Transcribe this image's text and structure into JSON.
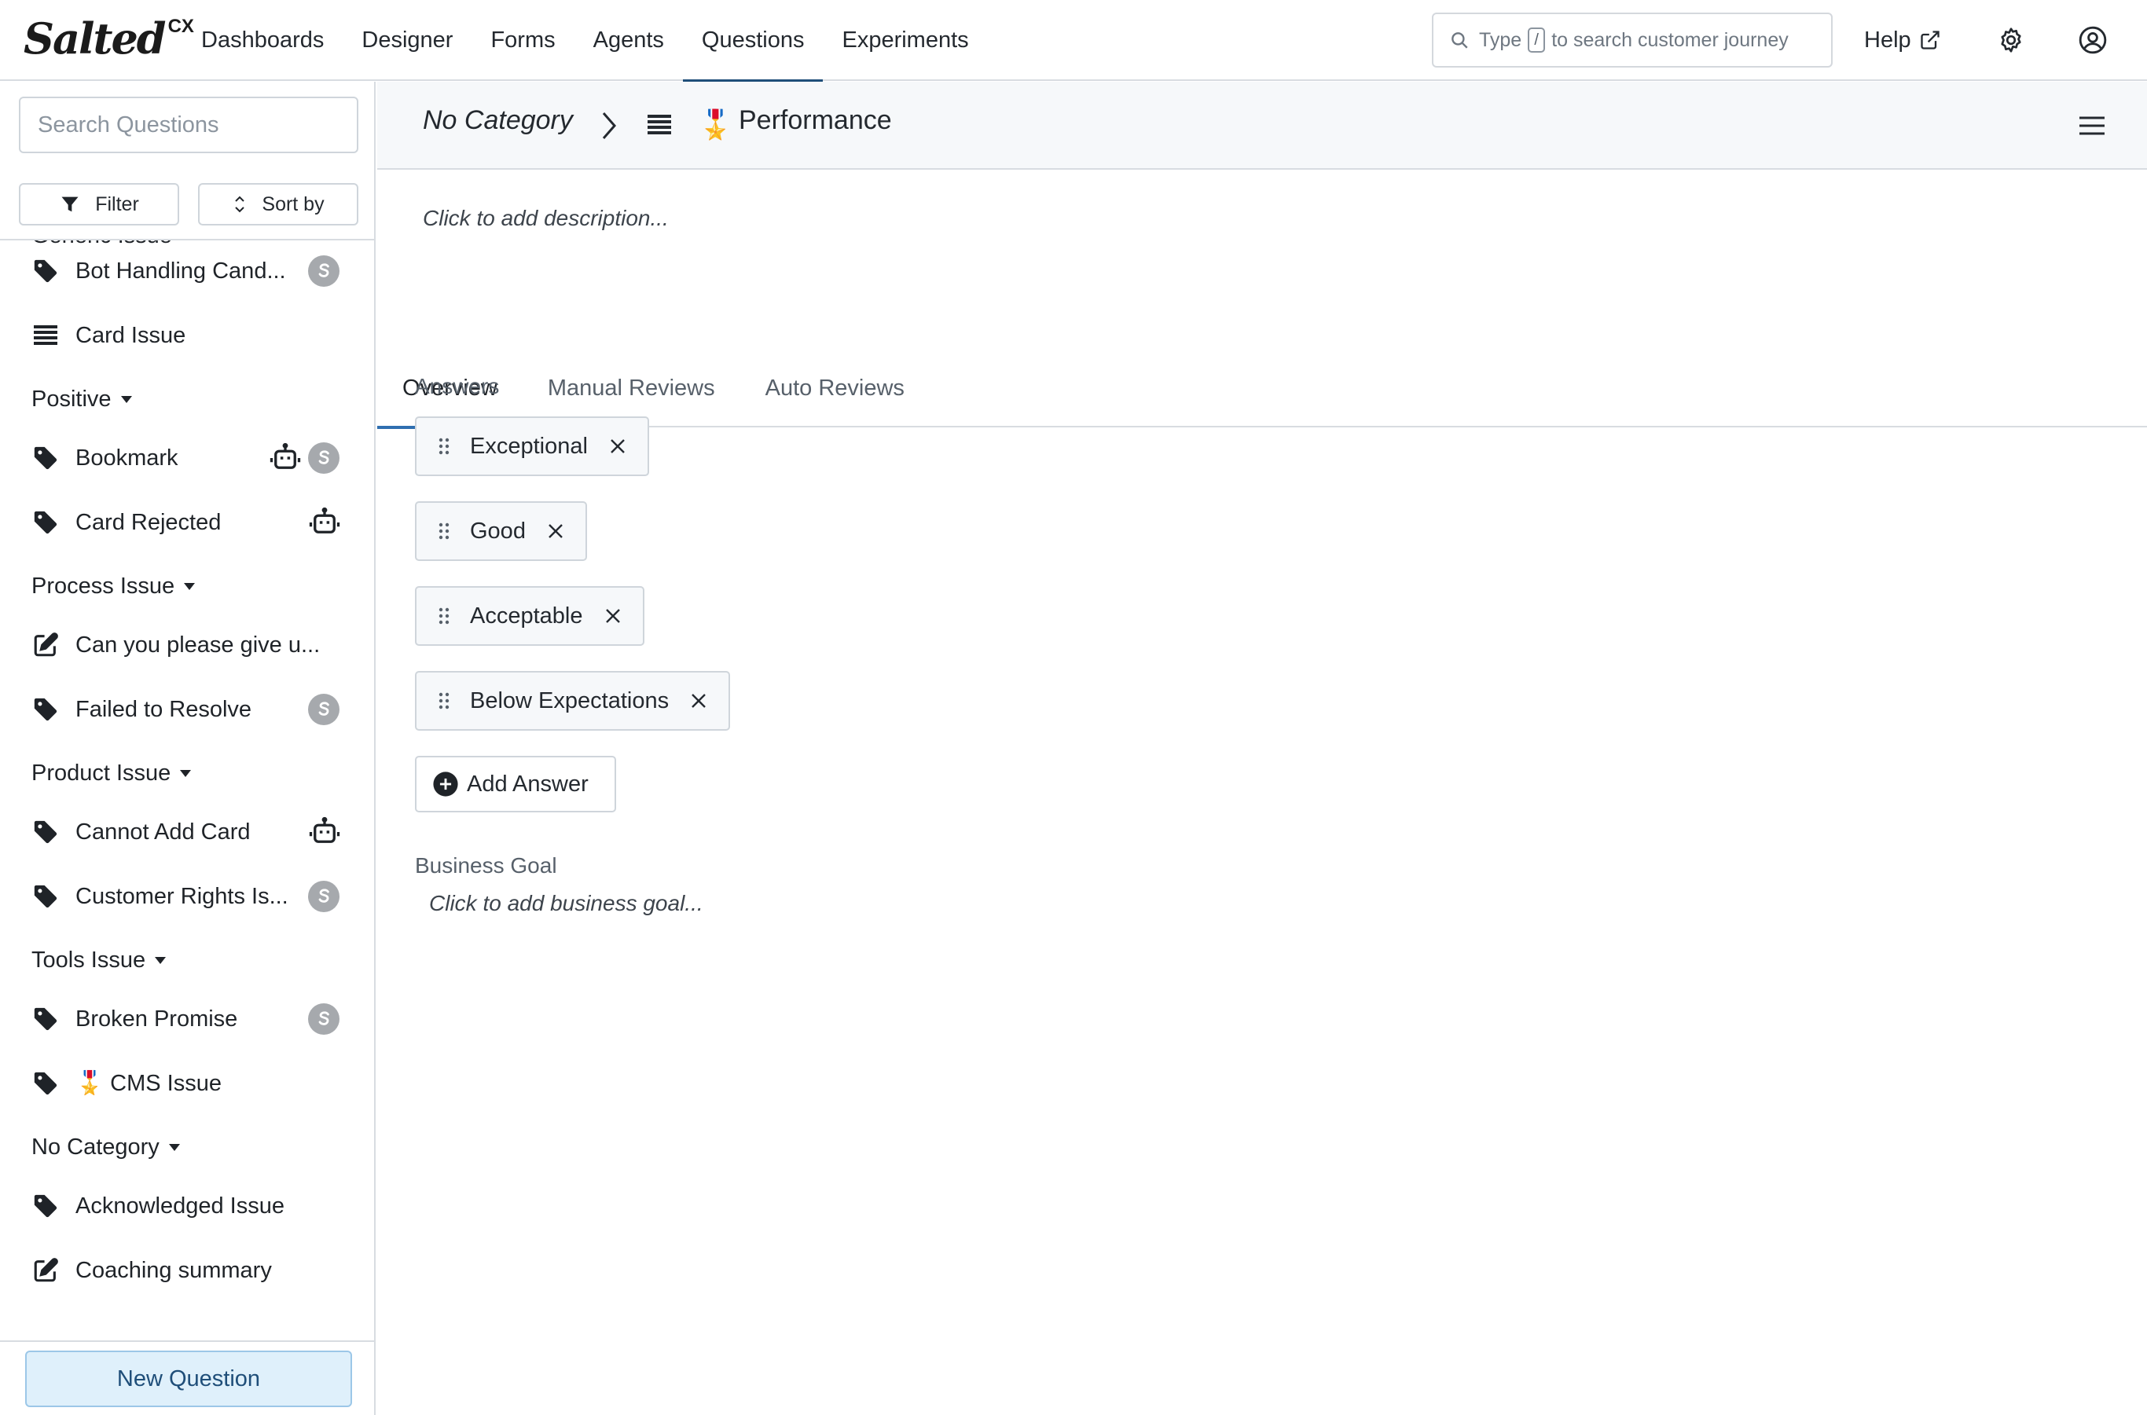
{
  "brand": {
    "name": "Salted",
    "suffix": "CX"
  },
  "nav": {
    "items": [
      "Dashboards",
      "Designer",
      "Forms",
      "Agents",
      "Questions",
      "Experiments"
    ],
    "active": "Questions"
  },
  "global_search": {
    "prefix": "Type",
    "key": "/",
    "suffix": "to search customer journey"
  },
  "help": {
    "label": "Help"
  },
  "sidebar": {
    "search_placeholder": "Search Questions",
    "filter_label": "Filter",
    "sort_label": "Sort by",
    "partial_group": "Generic Issue",
    "rows": [
      {
        "label": "Bot Handling Cand...",
        "icon": "tag-icon",
        "bot": false,
        "salted": true
      },
      {
        "label": "Card Issue",
        "icon": "list-icon",
        "bot": false,
        "salted": false
      },
      {
        "label": "Positive",
        "group": true
      },
      {
        "label": "Bookmark",
        "icon": "tag-icon",
        "bot": true,
        "salted": true
      },
      {
        "label": "Card Rejected",
        "icon": "tag-icon",
        "bot": true,
        "salted": false
      },
      {
        "label": "Process Issue",
        "group": true
      },
      {
        "label": "Can you please give u...",
        "icon": "edit-icon",
        "bot": false,
        "salted": false
      },
      {
        "label": "Failed to Resolve",
        "icon": "tag-icon",
        "bot": false,
        "salted": true
      },
      {
        "label": "Product Issue",
        "group": true
      },
      {
        "label": "Cannot Add Card",
        "icon": "tag-icon",
        "bot": true,
        "salted": false
      },
      {
        "label": "Customer Rights Is...",
        "icon": "tag-icon",
        "bot": false,
        "salted": true
      },
      {
        "label": "Tools Issue",
        "group": true
      },
      {
        "label": "Broken Promise",
        "icon": "tag-icon",
        "bot": false,
        "salted": true
      },
      {
        "label": "🎖️ CMS Issue",
        "icon": "tag-icon",
        "bot": false,
        "salted": false
      },
      {
        "label": "No Category",
        "group": true
      },
      {
        "label": "Acknowledged Issue",
        "icon": "tag-icon",
        "bot": false,
        "salted": false
      },
      {
        "label": "Coaching summary",
        "icon": "edit-icon",
        "bot": false,
        "salted": false
      }
    ],
    "new_question_label": "New Question"
  },
  "main": {
    "breadcrumb_category": "No Category",
    "medal": "🎖️",
    "title": "Performance",
    "description_placeholder": "Click to add description...",
    "tabs": [
      "Overview",
      "Manual Reviews",
      "Auto Reviews"
    ],
    "active_tab": "Overview",
    "answers_label": "Answers",
    "answers": [
      "Exceptional",
      "Good",
      "Acceptable",
      "Below Expectations"
    ],
    "add_answer_label": "Add Answer",
    "business_goal_label": "Business Goal",
    "business_goal_placeholder": "Click to add business goal..."
  },
  "colors": {
    "accent": "#1f4e79",
    "tab_underline": "#2f6fb0",
    "new_question_bg": "#dff0fb",
    "badge_gray": "#a6a9ad"
  }
}
